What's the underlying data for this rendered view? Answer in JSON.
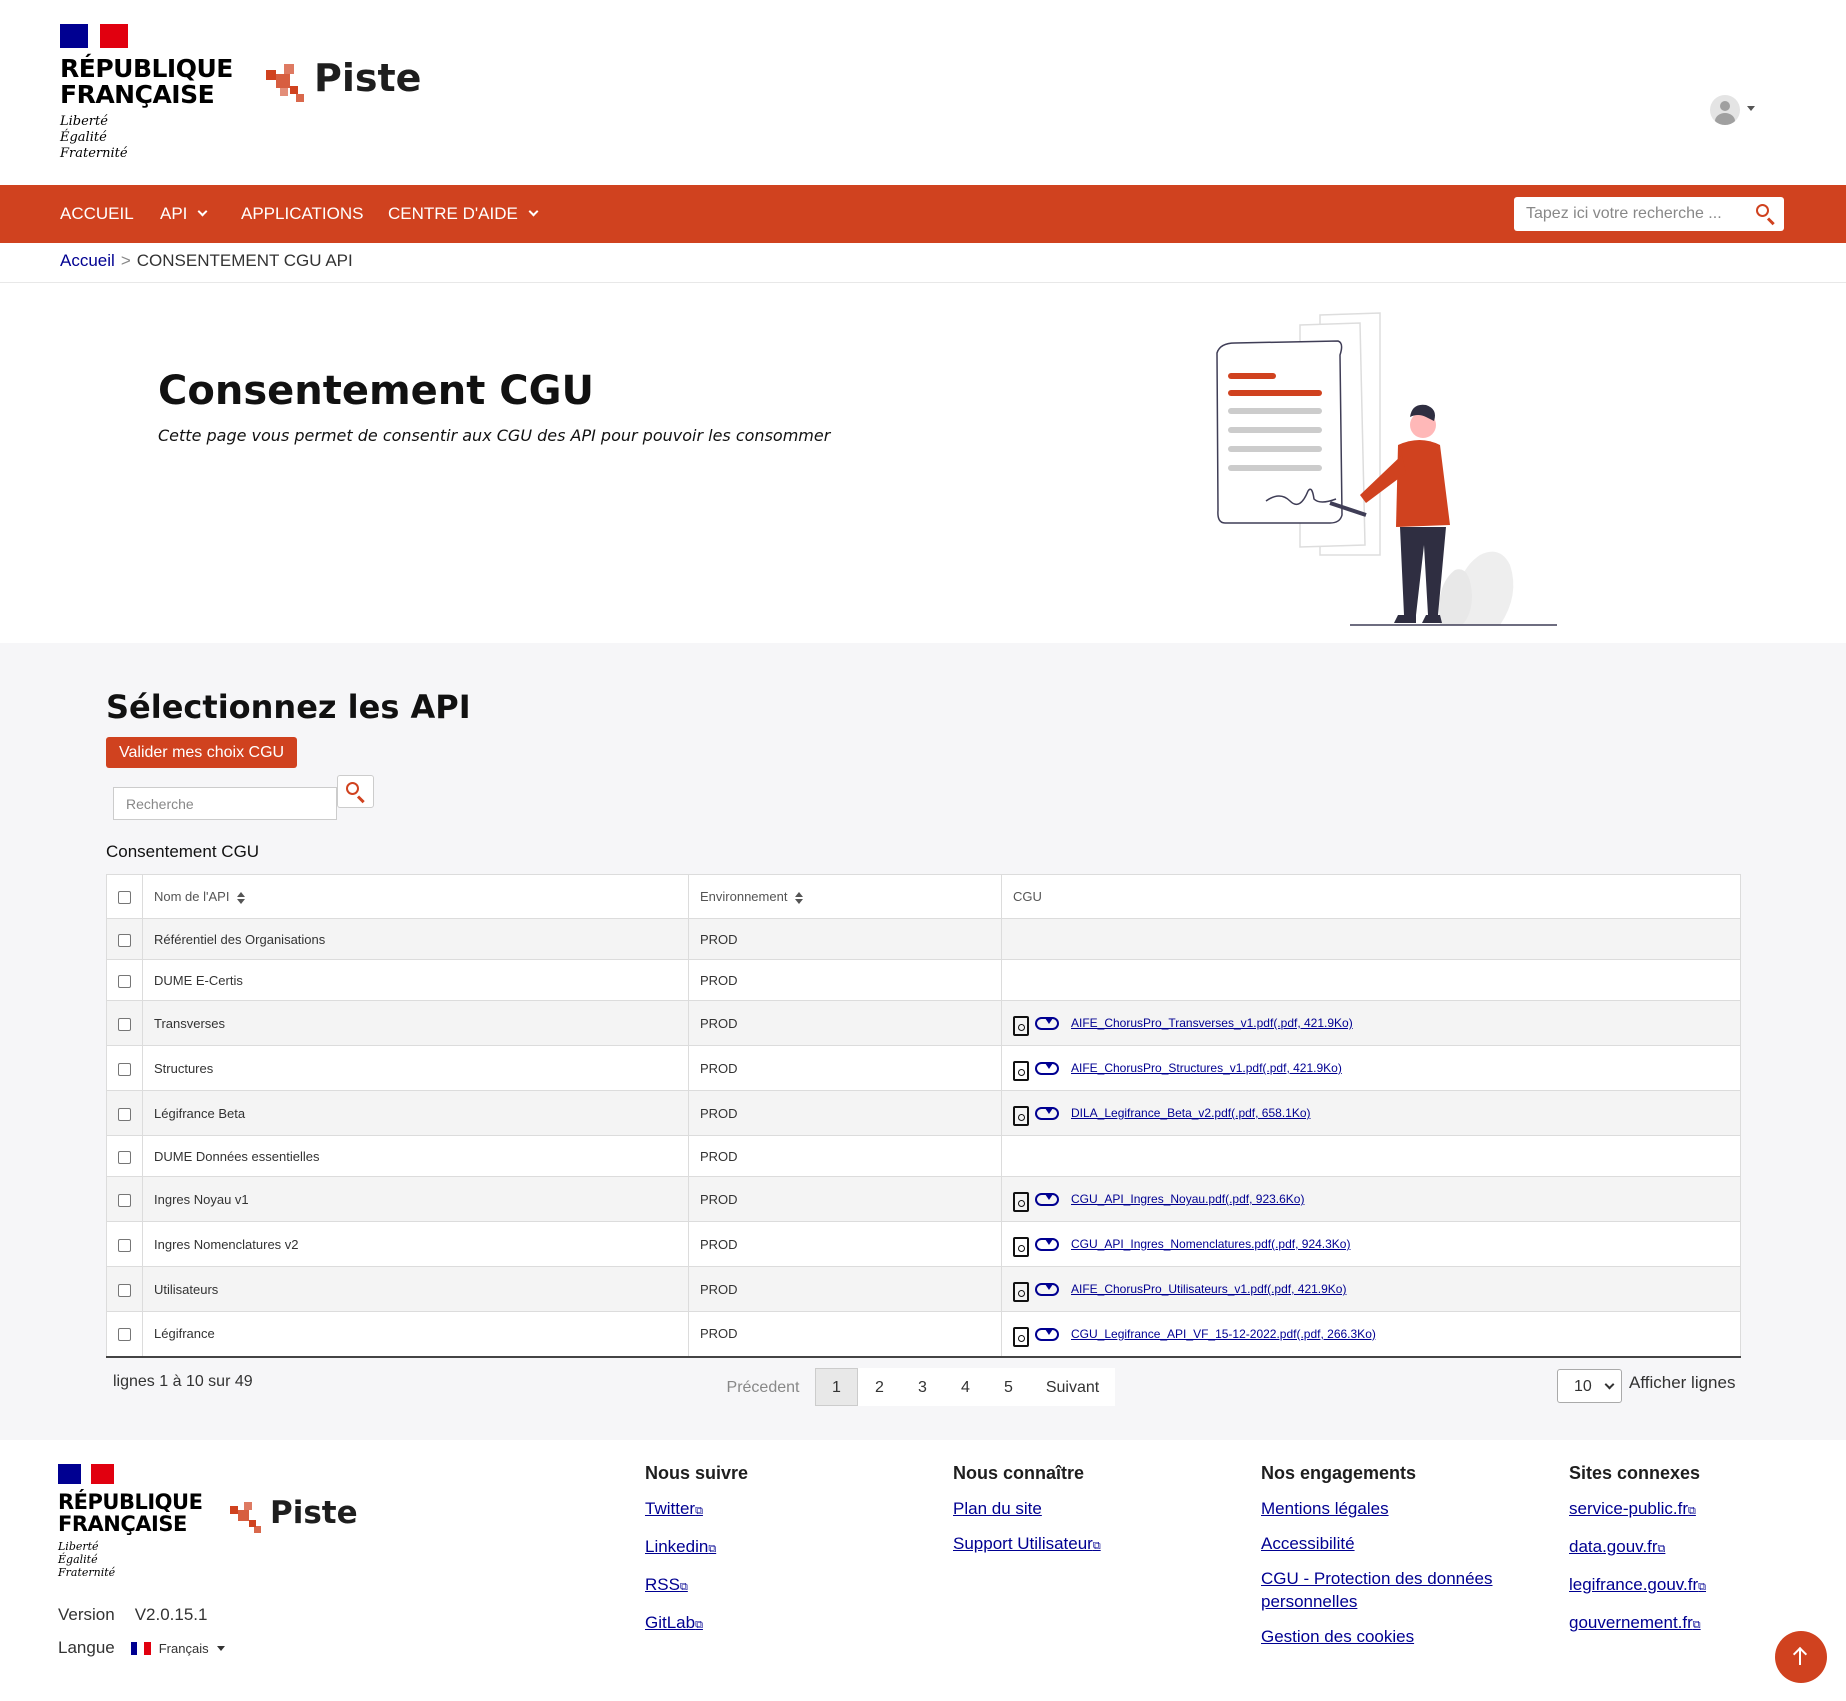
{
  "header": {
    "rf_lines": [
      "RÉPUBLIQUE",
      "FRANÇAISE"
    ],
    "motto": [
      "Liberté",
      "Égalité",
      "Fraternité"
    ],
    "brand": "Piste"
  },
  "nav": {
    "items": [
      {
        "label": "ACCUEIL"
      },
      {
        "label": "API"
      },
      {
        "label": "APPLICATIONS"
      },
      {
        "label": "CENTRE D'AIDE"
      }
    ],
    "search_placeholder": "Tapez ici votre recherche ..."
  },
  "breadcrumb": {
    "home": "Accueil",
    "separator": ">",
    "current": "CONSENTEMENT CGU API"
  },
  "hero": {
    "title": "Consentement CGU",
    "subtitle": "Cette page vous permet de consentir aux CGU des API pour pouvoir les consommer"
  },
  "selection": {
    "title": "Sélectionnez les API",
    "validate_button": "Valider mes choix CGU",
    "search_placeholder": "Recherche",
    "table_caption": "Consentement CGU"
  },
  "table": {
    "columns": [
      "Nom de l'API",
      "Environnement",
      "CGU"
    ],
    "rows": [
      {
        "name": "Référentiel des Organisations",
        "env": "PROD",
        "cgu": ""
      },
      {
        "name": "DUME E-Certis",
        "env": "PROD",
        "cgu": ""
      },
      {
        "name": "Transverses",
        "env": "PROD",
        "cgu": "AIFE_ChorusPro_Transverses_v1.pdf(.pdf, 421.9Ko)"
      },
      {
        "name": "Structures",
        "env": "PROD",
        "cgu": "AIFE_ChorusPro_Structures_v1.pdf(.pdf, 421.9Ko)"
      },
      {
        "name": "Légifrance Beta",
        "env": "PROD",
        "cgu": "DILA_Legifrance_Beta_v2.pdf(.pdf, 658.1Ko)"
      },
      {
        "name": "DUME Données essentielles",
        "env": "PROD",
        "cgu": ""
      },
      {
        "name": "Ingres Noyau v1",
        "env": "PROD",
        "cgu": "CGU_API_Ingres_Noyau.pdf(.pdf, 923.6Ko)"
      },
      {
        "name": "Ingres Nomenclatures v2",
        "env": "PROD",
        "cgu": "CGU_API_Ingres_Nomenclatures.pdf(.pdf, 924.3Ko)"
      },
      {
        "name": "Utilisateurs",
        "env": "PROD",
        "cgu": "AIFE_ChorusPro_Utilisateurs_v1.pdf(.pdf, 421.9Ko)"
      },
      {
        "name": "Légifrance",
        "env": "PROD",
        "cgu": "CGU_Legifrance_API_VF_15-12-2022.pdf(.pdf, 266.3Ko)"
      }
    ]
  },
  "pagination": {
    "info": "lignes 1 à 10 sur 49",
    "prev": "Précedent",
    "pages": [
      "1",
      "2",
      "3",
      "4",
      "5"
    ],
    "current_page": "1",
    "next": "Suivant",
    "page_size": "10",
    "page_size_label": "Afficher lignes"
  },
  "footer": {
    "brand": "Piste",
    "version_label": "Version",
    "version": "V2.0.15.1",
    "langue_label": "Langue",
    "langue": "Français",
    "columns": [
      {
        "title": "Nous suivre",
        "links": [
          "Twitter",
          "Linkedin",
          "RSS",
          "GitLab"
        ]
      },
      {
        "title": "Nous connaître",
        "links": [
          "Plan du site",
          "Support Utilisateur"
        ]
      },
      {
        "title": "Nos engagements",
        "links": [
          "Mentions légales",
          "Accessibilité",
          "CGU - Protection des données personnelles",
          "Gestion des cookies"
        ]
      },
      {
        "title": "Sites connexes",
        "links": [
          "service-public.fr",
          "data.gouv.fr",
          "legifrance.gouv.fr",
          "gouvernement.fr"
        ]
      }
    ]
  },
  "colors": {
    "brand": "#d0421f",
    "link": "#000091",
    "gray_bg": "#f6f6f8"
  }
}
